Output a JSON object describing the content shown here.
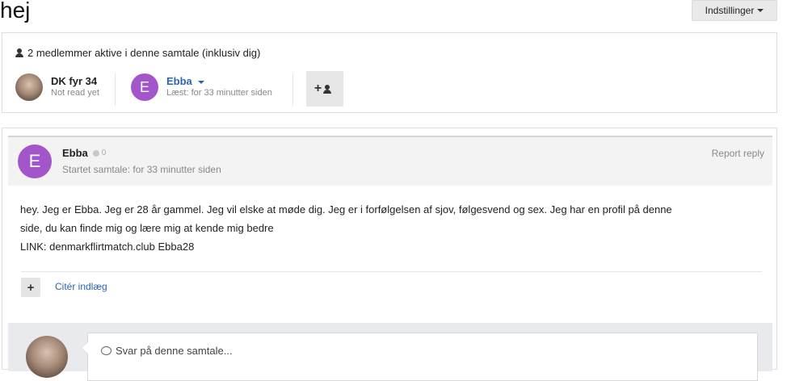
{
  "page": {
    "title": "hej"
  },
  "toolbar": {
    "settings_label": "Indstillinger"
  },
  "members": {
    "header": "2 medlemmer aktive i denne samtale (inklusiv dig)",
    "list": [
      {
        "name": "DK fyr 34",
        "status": "Not read yet",
        "avatar_letter": ""
      },
      {
        "name": "Ebba",
        "status": "Læst: for 33 minutter siden",
        "avatar_letter": "E"
      }
    ],
    "add_member_label": "+"
  },
  "post": {
    "author": "Ebba",
    "reputation": "0",
    "avatar_letter": "E",
    "started": "Startet samtale: for 33 minutter siden",
    "report_label": "Report reply",
    "body_line1": "hey. Jeg er Ebba. Jeg er 28 år gammel. Jeg vil elske at møde dig. Jeg er i forfølgelsen af sjov, følgesvend og sex. Jeg har en profil på denne",
    "body_line2": "side, du kan finde mig og lære mig at kende mig bedre",
    "body_line3": "LINK: denmarkflirtmatch.club Ebba28",
    "quote_plus": "+",
    "quote_label": "Citér indlæg"
  },
  "reply": {
    "placeholder": "Svar på denne samtale..."
  },
  "colors": {
    "accent": "#2b64b3",
    "avatar_purple": "#a256c9"
  }
}
